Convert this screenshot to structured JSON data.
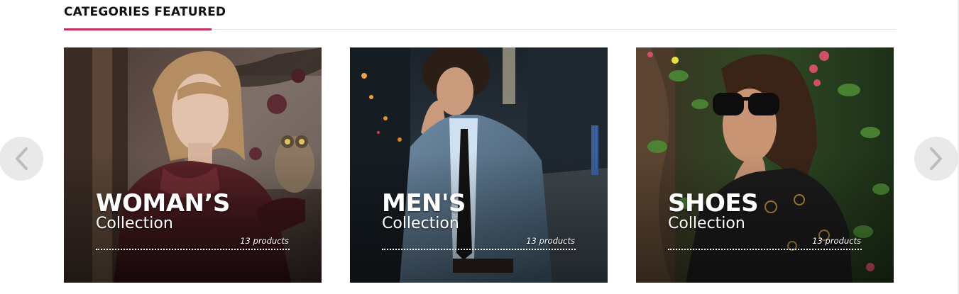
{
  "section": {
    "title": "CATEGORIES FEATURED",
    "accent_color": "#c2305b"
  },
  "carousel": {
    "prev_icon": "chevron-left-icon",
    "next_icon": "chevron-right-icon",
    "categories": [
      {
        "title": "WOMAN’S",
        "subtitle": "Collection",
        "count": "13 products"
      },
      {
        "title": "MEN'S",
        "subtitle": "Collection",
        "count": "13 products"
      },
      {
        "title": "SHOES",
        "subtitle": "Collection",
        "count": "13 products"
      }
    ]
  }
}
